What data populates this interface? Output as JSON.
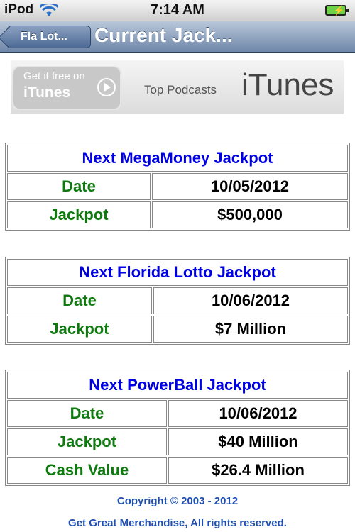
{
  "status_bar": {
    "carrier": "iPod",
    "time": "7:14 AM"
  },
  "nav": {
    "back_label": "Fla Lot...",
    "title": "Current Jack..."
  },
  "ad": {
    "free_text": "Get it free on",
    "itunes_small": "iTunes",
    "podcasts": "Top Podcasts",
    "brand": "iTunes"
  },
  "tables": [
    {
      "title": "Next MegaMoney Jackpot",
      "rows": [
        {
          "label": "Date",
          "value": "10/05/2012"
        },
        {
          "label": "Jackpot",
          "value": "$500,000"
        }
      ]
    },
    {
      "title": "Next Florida Lotto Jackpot",
      "rows": [
        {
          "label": "Date",
          "value": "10/06/2012"
        },
        {
          "label": "Jackpot",
          "value": "$7 Million"
        }
      ]
    },
    {
      "title": "Next PowerBall Jackpot",
      "rows": [
        {
          "label": "Date",
          "value": "10/06/2012"
        },
        {
          "label": "Jackpot",
          "value": "$40 Million"
        },
        {
          "label": "Cash Value",
          "value": "$26.4 Million"
        }
      ]
    }
  ],
  "footer": {
    "copyright": "Copyright © 2003 - 2012",
    "rights": "Get Great Merchandise, All rights reserved."
  },
  "colors": {
    "title_blue": "#0000e6",
    "label_green": "#0f7a0f",
    "nav_blue": "#6d85a8",
    "footer_blue": "#1f4fb0"
  }
}
